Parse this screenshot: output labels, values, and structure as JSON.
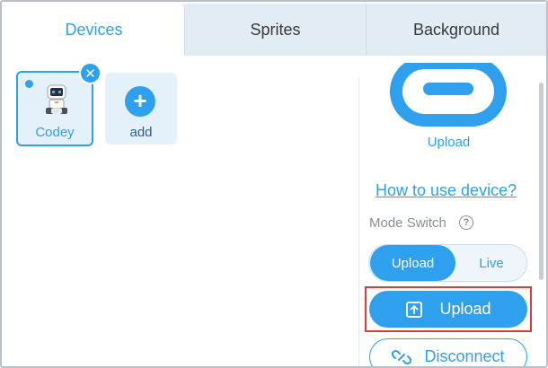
{
  "tabs": [
    {
      "label": "Devices",
      "active": true
    },
    {
      "label": "Sprites",
      "active": false
    },
    {
      "label": "Background",
      "active": false
    }
  ],
  "devices": [
    {
      "label": "Codey",
      "selected": true,
      "icon": "codey-robot-icon"
    }
  ],
  "add_device": {
    "label": "add",
    "icon": "plus-icon"
  },
  "connection": {
    "icon": "link-icon",
    "caption": "Upload"
  },
  "help_link": "How to use device?",
  "mode_switch": {
    "label": "Mode Switch",
    "info_icon": "?",
    "options": [
      "Upload",
      "Live"
    ],
    "selected": "Upload"
  },
  "actions": {
    "upload_label": "Upload",
    "disconnect_label": "Disconnect"
  },
  "colors": {
    "accent": "#2ea0ee",
    "highlight": "#e53935"
  }
}
